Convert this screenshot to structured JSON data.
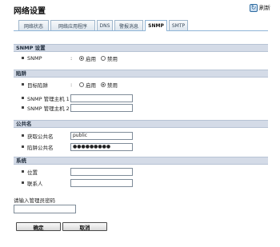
{
  "page": {
    "title": "网络设置",
    "refresh_label": "刷新"
  },
  "tabs": [
    {
      "label": "网络状态",
      "active": false
    },
    {
      "label": "网络应用程序",
      "active": false
    },
    {
      "label": "DNS",
      "active": false
    },
    {
      "label": "警报消息",
      "active": false
    },
    {
      "label": "SNMP",
      "active": true
    },
    {
      "label": "SMTP",
      "active": false
    }
  ],
  "snmp_settings": {
    "header": "SNMP 设置",
    "snmp_label": "SNMP",
    "enable_label": "启用",
    "disable_label": "禁用",
    "selected": "enable"
  },
  "trap": {
    "header": "陷阱",
    "target_label": "目标陷阱",
    "enable_label": "启用",
    "disable_label": "禁用",
    "selected": "disable",
    "manager1_label": "SNMP 管理主机 1",
    "manager1_value": "",
    "manager2_label": "SNMP 管理主机 2",
    "manager2_value": ""
  },
  "community": {
    "header": "公共名",
    "get_label": "获取公共名",
    "get_value": "public",
    "trap_label": "陷阱公共名",
    "trap_value": "●●●●●●●●●"
  },
  "system": {
    "header": "系统",
    "location_label": "位置",
    "location_value": "",
    "contact_label": "联系人",
    "contact_value": ""
  },
  "admin": {
    "prompt": "请输入管理员密码",
    "value": ""
  },
  "buttons": {
    "ok": "确定",
    "cancel": "取消"
  },
  "colors": {
    "section_bg": "#d4dbe7",
    "tab_border": "#8fb4d6"
  }
}
